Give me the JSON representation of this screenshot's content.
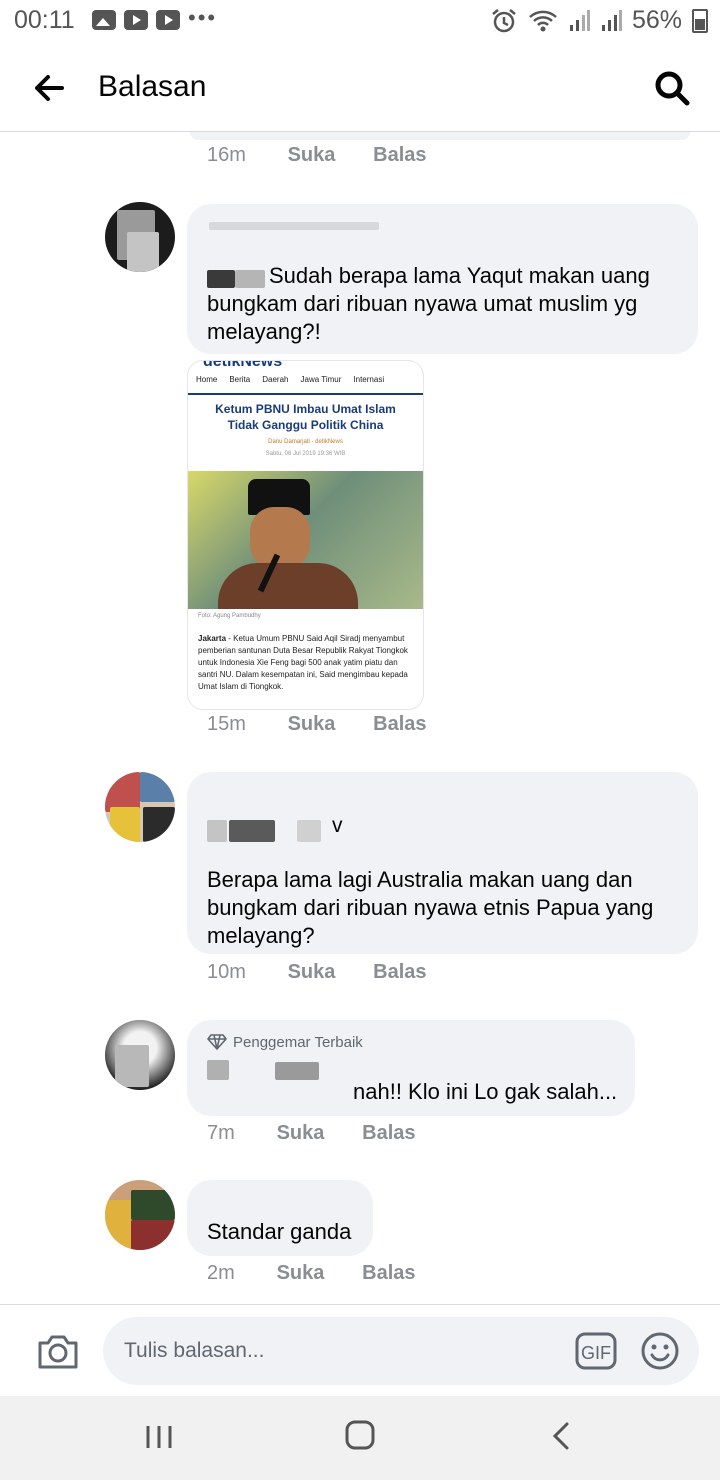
{
  "status_bar": {
    "time": "00:11",
    "overflow": "•••",
    "battery": "56%"
  },
  "header": {
    "title": "Balasan"
  },
  "prev_reply": {
    "time": "16m",
    "like": "Suka",
    "reply": "Balas"
  },
  "comments": [
    {
      "text": "Sudah berapa lama Yaqut makan uang\nbungkam dari ribuan nyawa umat muslim yg\nmelayang?!",
      "time": "15m",
      "like": "Suka",
      "reply": "Balas"
    },
    {
      "name_fragment": "v",
      "text": "Berapa lama lagi Australia makan uang dan\nbungkam dari ribuan nyawa etnis Papua yang\nmelayang?",
      "time": "10m",
      "like": "Suka",
      "reply": "Balas"
    },
    {
      "badge": "Penggemar Terbaik",
      "text": "nah!! Klo ini Lo gak salah...",
      "time": "7m",
      "like": "Suka",
      "reply": "Balas"
    },
    {
      "text": "Standar ganda",
      "time": "2m",
      "like": "Suka",
      "reply": "Balas"
    }
  ],
  "shared_article": {
    "site": "detikNews",
    "nav": [
      "Home",
      "Berita",
      "Daerah",
      "Jawa Timur",
      "Internasi"
    ],
    "headline": "Ketum PBNU Imbau Umat Islam Tidak Ganggu Politik China",
    "byline": "Danu Damarjati - detikNews",
    "date": "Sabtu, 06 Jul 2019 19:36 WIB",
    "caption": "Foto: Agung Pambudhy",
    "body_city": "Jakarta",
    "body": " - Ketua Umum PBNU Said Aqil Siradj menyambut pemberian santunan Duta Besar Republik Rakyat Tiongkok untuk Indonesia Xie Feng bagi 500 anak yatim piatu dan santri NU. Dalam kesempatan ini, Said mengimbau kepada Umat Islam di Tiongkok."
  },
  "composer": {
    "placeholder": "Tulis balasan...",
    "gif_label": "GIF"
  },
  "colors": {
    "bubble": "#f0f2f5",
    "meta_text": "#8a8d91",
    "detik_blue": "#1a3b7a"
  }
}
